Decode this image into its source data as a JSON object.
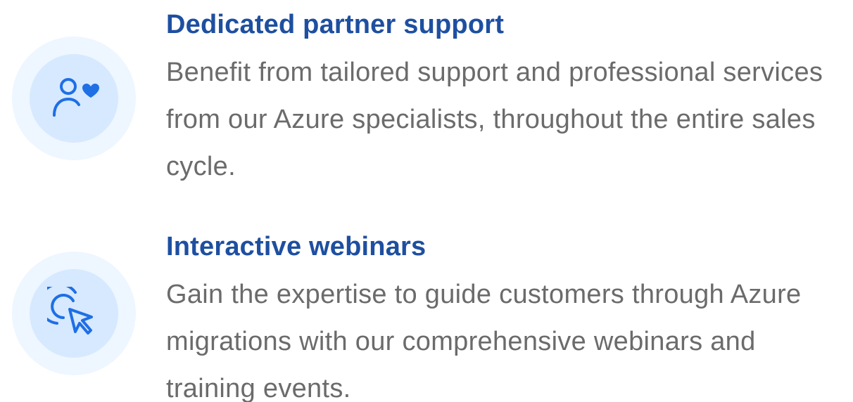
{
  "features": [
    {
      "icon": "user-heart-icon",
      "title": "Dedicated partner support",
      "description": "Benefit from tailored support and professional services from our Azure specialists, throughout the entire sales cycle."
    },
    {
      "icon": "cursor-click-icon",
      "title": "Interactive webinars",
      "description": "Gain the expertise to guide customers through Azure migrations with our comprehensive webinars and training events."
    }
  ],
  "colors": {
    "title": "#1e4fa0",
    "body_text": "#6b6b6b",
    "icon_stroke": "#1f6fe5",
    "badge_outer": "#eef6ff",
    "badge_inner": "#d6e9ff"
  }
}
